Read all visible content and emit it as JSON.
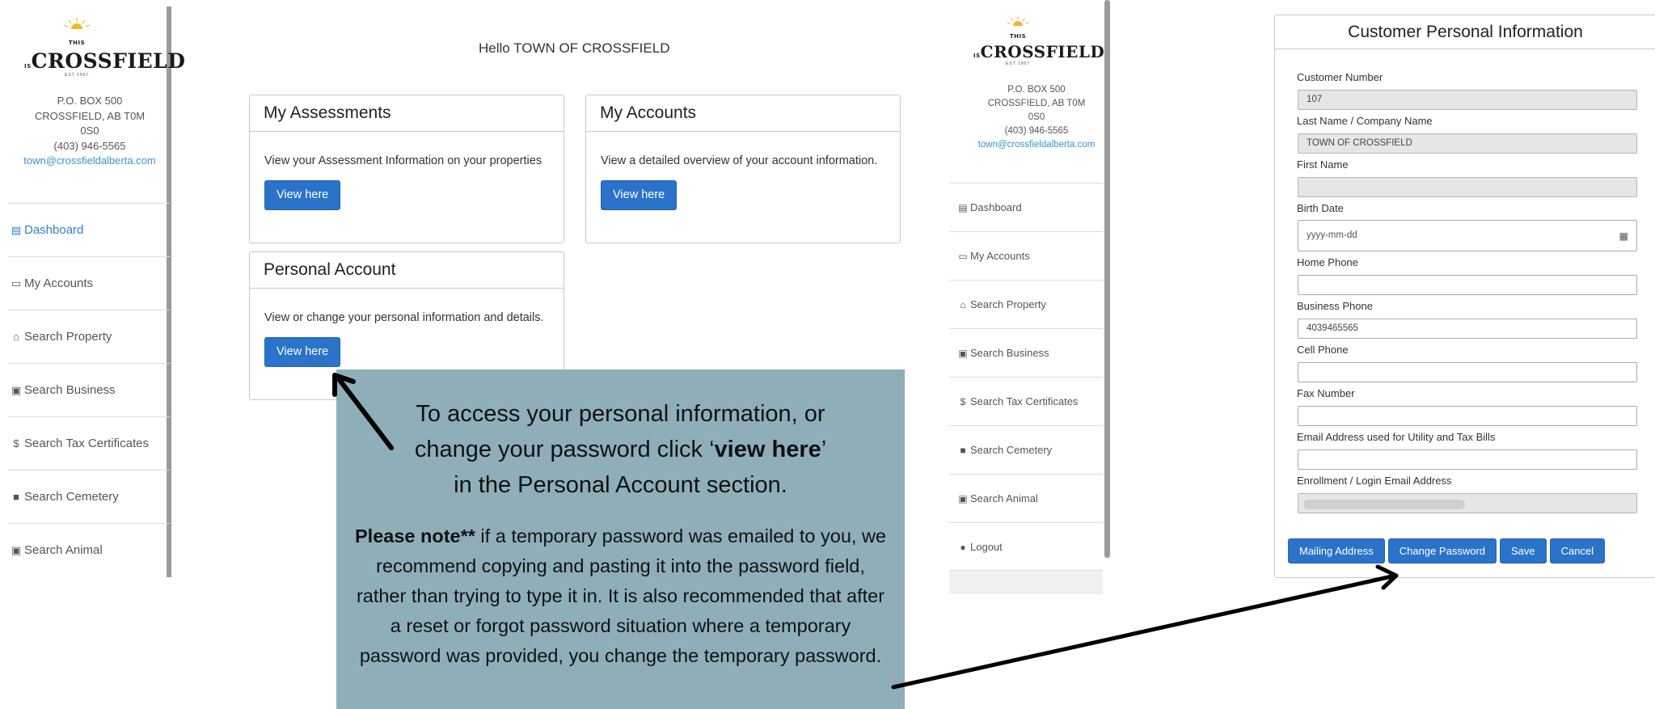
{
  "logo": {
    "small": "THIS IS",
    "main": "CROSSFIELD",
    "sub": "EST 1907"
  },
  "address": {
    "line1": "P.O. BOX 500",
    "line2": "CROSSFIELD, AB T0M",
    "line3": "0S0",
    "phone": "(403) 946-5565",
    "email": "town@crossfieldalberta.com"
  },
  "sidebar_left": {
    "items": [
      {
        "label": "Dashboard",
        "icon": "dashboard-icon"
      },
      {
        "label": "My Accounts",
        "icon": "folder-open-icon"
      },
      {
        "label": "Search Property",
        "icon": "home-icon"
      },
      {
        "label": "Search Business",
        "icon": "briefcase-icon"
      },
      {
        "label": "Search Tax Certificates",
        "icon": "dollar-icon"
      },
      {
        "label": "Search Cemetery",
        "icon": "tombstone-icon"
      },
      {
        "label": "Search Animal",
        "icon": "briefcase-icon"
      }
    ]
  },
  "sidebar_right": {
    "items": [
      {
        "label": "Dashboard"
      },
      {
        "label": "My Accounts"
      },
      {
        "label": "Search Property"
      },
      {
        "label": "Search Business"
      },
      {
        "label": "Search Tax Certificates"
      },
      {
        "label": "Search Cemetery"
      },
      {
        "label": "Search Animal"
      },
      {
        "label": "Logout"
      }
    ]
  },
  "dashboard": {
    "greeting": "Hello TOWN OF CROSSFIELD",
    "panels": {
      "assessments": {
        "title": "My Assessments",
        "text": "View your Assessment Information on your properties",
        "button": "View here"
      },
      "accounts": {
        "title": "My Accounts",
        "text": "View a detailed overview of your account information.",
        "button": "View here"
      },
      "personal": {
        "title": "Personal Account",
        "text": "View or change your personal information and details.",
        "button": "View here"
      }
    }
  },
  "callout": {
    "line1": "To access your personal information, or",
    "line2_pre": "change your password click ‘",
    "line2_bold": "view here",
    "line2_post": "’",
    "line3": "in the Personal Account section.",
    "note_bold": "Please note**",
    "note_text": " if a temporary password was emailed to you, we recommend copying and pasting it into the password field, rather than trying to type it in. It is also recommended that after a reset or forgot password situation where a temporary password was provided, you change the temporary password."
  },
  "form": {
    "title": "Customer Personal Information",
    "fields": {
      "customer_number": {
        "label": "Customer Number",
        "value": "107"
      },
      "last_name": {
        "label": "Last Name / Company Name",
        "value": "TOWN OF CROSSFIELD"
      },
      "first_name": {
        "label": "First Name",
        "value": ""
      },
      "birth_date": {
        "label": "Birth Date",
        "placeholder": "yyyy-mm-dd"
      },
      "home_phone": {
        "label": "Home Phone",
        "value": ""
      },
      "business_phone": {
        "label": "Business Phone",
        "value": "4039465565"
      },
      "cell_phone": {
        "label": "Cell Phone",
        "value": ""
      },
      "fax_number": {
        "label": "Fax Number",
        "value": ""
      },
      "billing_email": {
        "label": "Email Address used for Utility and Tax Bills",
        "value": ""
      },
      "login_email": {
        "label": "Enrollment / Login Email Address",
        "value": ""
      }
    },
    "buttons": {
      "mailing": "Mailing Address",
      "change_password": "Change Password",
      "save": "Save",
      "cancel": "Cancel"
    }
  }
}
